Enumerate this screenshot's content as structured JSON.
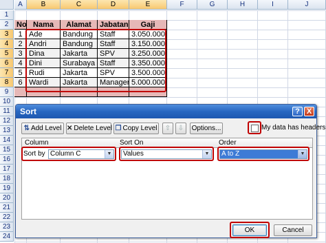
{
  "sheet": {
    "columns": [
      "A",
      "B",
      "C",
      "D",
      "E",
      "F",
      "G",
      "H",
      "I",
      "J"
    ],
    "rows": [
      "1",
      "2",
      "3",
      "4",
      "5",
      "6",
      "7",
      "8",
      "9",
      "10",
      "11",
      "12",
      "13",
      "14",
      "15",
      "16",
      "17",
      "18",
      "19",
      "20",
      "21",
      "22",
      "23",
      "24"
    ],
    "table": {
      "headers": [
        "No",
        "Nama",
        "Alamat",
        "Jabatan",
        "Gaji"
      ],
      "rows": [
        [
          "1",
          "Ade",
          "Bandung",
          "Staff",
          "3.050.000"
        ],
        [
          "2",
          "Andri",
          "Bandung",
          "Staff",
          "3.150.000"
        ],
        [
          "3",
          "Dina",
          "Jakarta",
          "SPV",
          "3.250.000"
        ],
        [
          "4",
          "Dini",
          "Surabaya",
          "Staff",
          "3.350.000"
        ],
        [
          "5",
          "Rudi",
          "Jakarta",
          "SPV",
          "3.500.000"
        ],
        [
          "6",
          "Wardi",
          "Jakarta",
          "Manager",
          "5.000.000"
        ]
      ]
    },
    "colors": {
      "header_fill": "#e6b8b7",
      "highlight_border": "#c00000"
    }
  },
  "dialog": {
    "title": "Sort",
    "help_label": "?",
    "close_label": "X",
    "toolbar": {
      "add_level": "Add Level",
      "delete_level": "Delete Level",
      "copy_level": "Copy Level",
      "move_up": "⇧",
      "move_down": "⇩",
      "options": "Options...",
      "my_data_has_headers": "My data has headers"
    },
    "list_headers": {
      "column": "Column",
      "sort_on": "Sort On",
      "order": "Order"
    },
    "level": {
      "label": "Sort by",
      "column_value": "Column C",
      "sort_on_value": "Values",
      "order_value": "A to Z"
    },
    "ok": "OK",
    "cancel": "Cancel"
  }
}
